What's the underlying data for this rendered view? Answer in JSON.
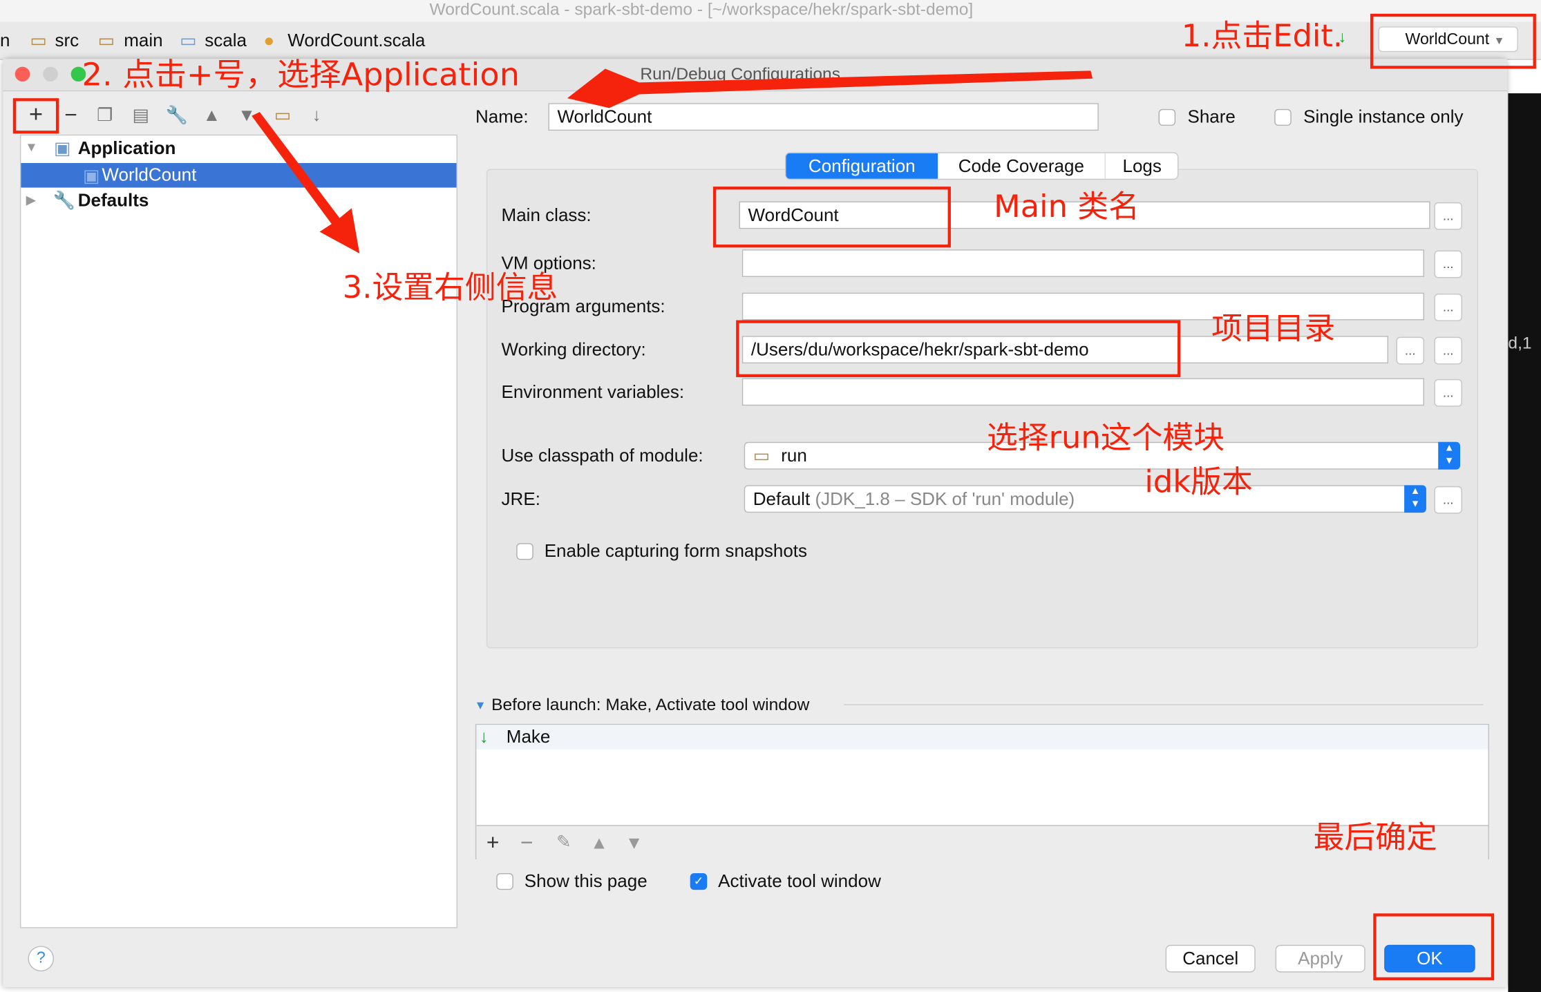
{
  "ide": {
    "window_title": "WordCount.scala - spark-sbt-demo - [~/workspace/hekr/spark-sbt-demo]",
    "breadcrumbs": [
      "n",
      "src",
      "main",
      "scala",
      "WordCount.scala"
    ],
    "run_config_selector": "WorldCount",
    "side_text": "d,1"
  },
  "dialog": {
    "title": "Run/Debug Configurations",
    "tree": {
      "application": "Application",
      "selected": "WorldCount",
      "defaults": "Defaults"
    },
    "name_label": "Name:",
    "name_value": "WorldCount",
    "share_label": "Share",
    "single_instance_label": "Single instance only",
    "tabs": [
      "Configuration",
      "Code Coverage",
      "Logs"
    ],
    "active_tab": "Configuration",
    "fields": {
      "main_class_label": "Main class:",
      "main_class_value": "WordCount",
      "vm_options_label": "VM options:",
      "vm_options_value": "",
      "program_args_label": "Program arguments:",
      "program_args_value": "",
      "working_dir_label": "Working directory:",
      "working_dir_value": "/Users/du/workspace/hekr/spark-sbt-demo",
      "env_vars_label": "Environment variables:",
      "env_vars_value": "",
      "classpath_label": "Use classpath of module:",
      "classpath_value": "run",
      "jre_label": "JRE:",
      "jre_value": "Default",
      "jre_detail": "(JDK_1.8 – SDK of 'run' module)",
      "snapshots_label": "Enable capturing form snapshots",
      "dots": "..."
    },
    "before_launch": {
      "header": "Before launch: Make, Activate tool window",
      "items": [
        "Make"
      ]
    },
    "show_page_label": "Show this page",
    "activate_tool_label": "Activate tool window",
    "help": "?",
    "cancel": "Cancel",
    "apply": "Apply",
    "ok": "OK"
  },
  "annotations": {
    "step1": "1.点击Edit.",
    "step2": "2. 点击+号，选择Application",
    "step3": "3.设置右侧信息",
    "main_class": "Main 类名",
    "project_dir": "项目目录",
    "module": "选择run这个模块",
    "jdk": "idk版本",
    "finish": "最后确定"
  },
  "colors": {
    "annotation": "#f5220c",
    "accent": "#3a75d6",
    "ok": "#1a7cf5"
  }
}
